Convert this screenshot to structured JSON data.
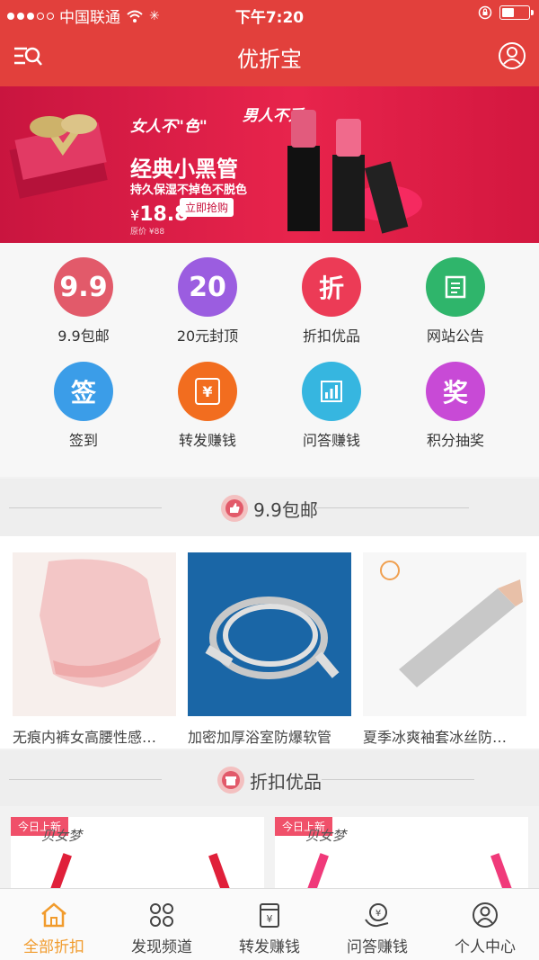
{
  "status_bar": {
    "carrier": "中国联通",
    "time": "下午7:20"
  },
  "nav": {
    "title": "优折宝",
    "menu_icon": "search-menu-icon",
    "user_icon": "user-icon"
  },
  "banner": {
    "line1": "女人不\"色\"",
    "line1b": "男人不爱",
    "title": "经典小黑管",
    "subtitle": "持久保湿不掉色不脱色",
    "price_prefix": "¥",
    "price": "18.8",
    "buy_label": "立即抢购",
    "small_text": "原价 ¥88",
    "slide_count": 3,
    "active_slide": 1
  },
  "grid": [
    {
      "label": "9.9包邮",
      "icon_text": "9.9",
      "color": "#e25a6a"
    },
    {
      "label": "20元封顶",
      "icon_text": "20",
      "color": "#9b5de0"
    },
    {
      "label": "折扣优品",
      "icon_text": "折",
      "color": "#ec3b56"
    },
    {
      "label": "网站公告",
      "icon_text": "",
      "color": "#2fb56b"
    },
    {
      "label": "签到",
      "icon_text": "签",
      "color": "#3b9de8"
    },
    {
      "label": "转发赚钱",
      "icon_text": "¥",
      "color": "#f26d1f"
    },
    {
      "label": "问答赚钱",
      "icon_text": "",
      "color": "#36b6e0"
    },
    {
      "label": "积分抽奖",
      "icon_text": "奖",
      "color": "#c84ad6"
    }
  ],
  "section1": {
    "title": "9.9包邮",
    "icon": "thumbs-up-icon"
  },
  "products": [
    {
      "name": "无痕内裤女高腰性感…"
    },
    {
      "name": "加密加厚浴室防爆软管"
    },
    {
      "name": "夏季冰爽袖套冰丝防…"
    }
  ],
  "section2": {
    "title": "折扣优品",
    "icon": "gift-icon"
  },
  "discount_items": [
    {
      "tag": "今日上新",
      "brand": "贝女梦"
    },
    {
      "tag": "今日上新",
      "brand": "贝女梦"
    }
  ],
  "tabbar": [
    {
      "label": "全部折扣",
      "icon": "home-icon",
      "active": true
    },
    {
      "label": "发现频道",
      "icon": "discover-icon",
      "active": false
    },
    {
      "label": "转发赚钱",
      "icon": "wallet-icon",
      "active": false
    },
    {
      "label": "问答赚钱",
      "icon": "qa-money-icon",
      "active": false
    },
    {
      "label": "个人中心",
      "icon": "profile-icon",
      "active": false
    }
  ],
  "colors": {
    "brand_red": "#e2403c",
    "tab_active": "#f19b2c"
  }
}
